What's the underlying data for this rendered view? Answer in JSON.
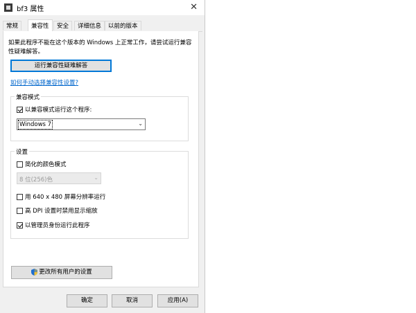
{
  "window": {
    "title": "bf3 属性",
    "close_glyph": "✕"
  },
  "tabs": [
    {
      "label": "常规"
    },
    {
      "label": "兼容性",
      "active": true
    },
    {
      "label": "安全"
    },
    {
      "label": "详细信息"
    },
    {
      "label": "以前的版本"
    }
  ],
  "compat": {
    "description": "如果此程序不能在这个版本的 Windows 上正常工作，请尝试运行兼容性疑难解答。",
    "run_troubleshooter": "运行兼容性疑难解答",
    "manual_link": "如何手动选择兼容性设置?"
  },
  "compat_mode": {
    "title": "兼容模式",
    "checkbox_label": "以兼容模式运行这个程序:",
    "checked": true,
    "selected_os": "Windows 7"
  },
  "settings": {
    "title": "设置",
    "reduced_color": {
      "label": "简化的颜色模式",
      "checked": false
    },
    "color_select": "8 位(256)色",
    "res_640": {
      "label": "用 640 x 480 屏幕分辨率运行",
      "checked": false
    },
    "high_dpi": {
      "label": "高 DPI 设置时禁用显示缩放",
      "checked": false
    },
    "run_admin": {
      "label": "以管理员身份运行此程序",
      "checked": true
    }
  },
  "change_all_users": "更改所有用户的设置",
  "footer": {
    "ok": "确定",
    "cancel": "取消",
    "apply": "应用(A)"
  },
  "colors": {
    "accent": "#0078d7",
    "link": "#0066cc",
    "dialog_bg": "#f0f0f0"
  },
  "icons": {
    "app": "app-icon",
    "close": "close-icon",
    "shield": "uac-shield-icon",
    "dropdown": "chevron-down-icon"
  }
}
